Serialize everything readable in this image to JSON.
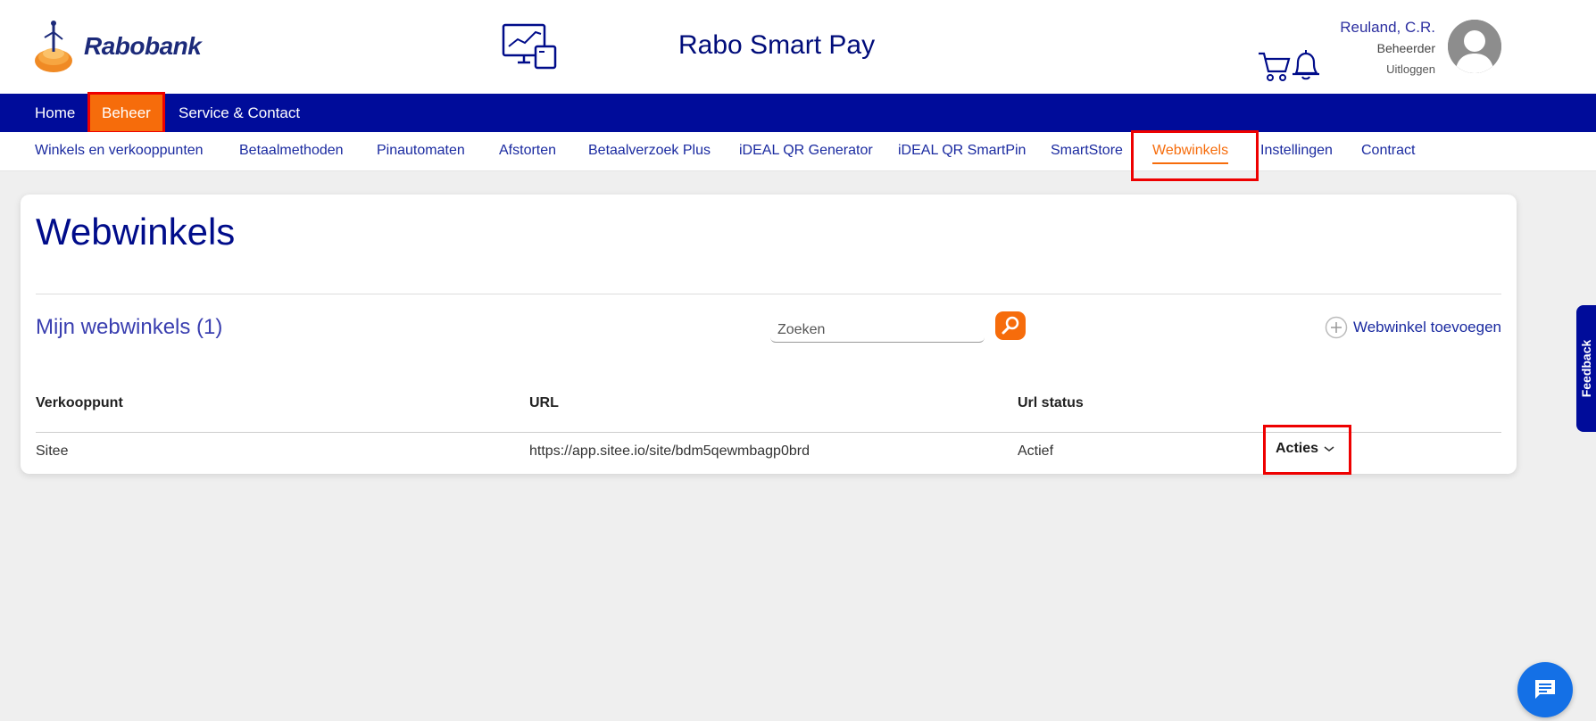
{
  "header": {
    "brand": "Rabobank",
    "app_title": "Rabo Smart Pay",
    "user": {
      "name": "Reuland, C.R.",
      "role": "Beheerder",
      "logout": "Uitloggen"
    },
    "icons": [
      "monitor-chart-icon",
      "cart-icon",
      "bell-icon",
      "avatar"
    ]
  },
  "main_nav": {
    "items": [
      {
        "label": "Home"
      },
      {
        "label": "Beheer",
        "active": true
      },
      {
        "label": "Service & Contact"
      }
    ]
  },
  "sub_nav": {
    "items": [
      {
        "label": "Winkels en verkooppunten"
      },
      {
        "label": "Betaalmethoden"
      },
      {
        "label": "Pinautomaten"
      },
      {
        "label": "Afstorten"
      },
      {
        "label": "Betaalverzoek Plus"
      },
      {
        "label": "iDEAL QR Generator"
      },
      {
        "label": "iDEAL QR SmartPin"
      },
      {
        "label": "SmartStore"
      },
      {
        "label": "Webwinkels",
        "active": true
      },
      {
        "label": "Instellingen"
      },
      {
        "label": "Contract"
      }
    ]
  },
  "page": {
    "title": "Webwinkels",
    "section_title": "Mijn webwinkels (1)",
    "search_placeholder": "Zoeken",
    "add_label": "Webwinkel toevoegen",
    "table": {
      "headers": [
        "Verkooppunt",
        "URL",
        "Url status"
      ],
      "rows": [
        {
          "verkooppunt": "Sitee",
          "url": "https://app.sitee.io/site/bdm5qewmbagp0brd",
          "status": "Actief",
          "action": "Acties"
        }
      ]
    }
  },
  "widgets": {
    "feedback": "Feedback"
  },
  "colors": {
    "brand_blue": "#000c9a",
    "accent_orange": "#f66c0b",
    "highlight_red": "#e00000"
  }
}
